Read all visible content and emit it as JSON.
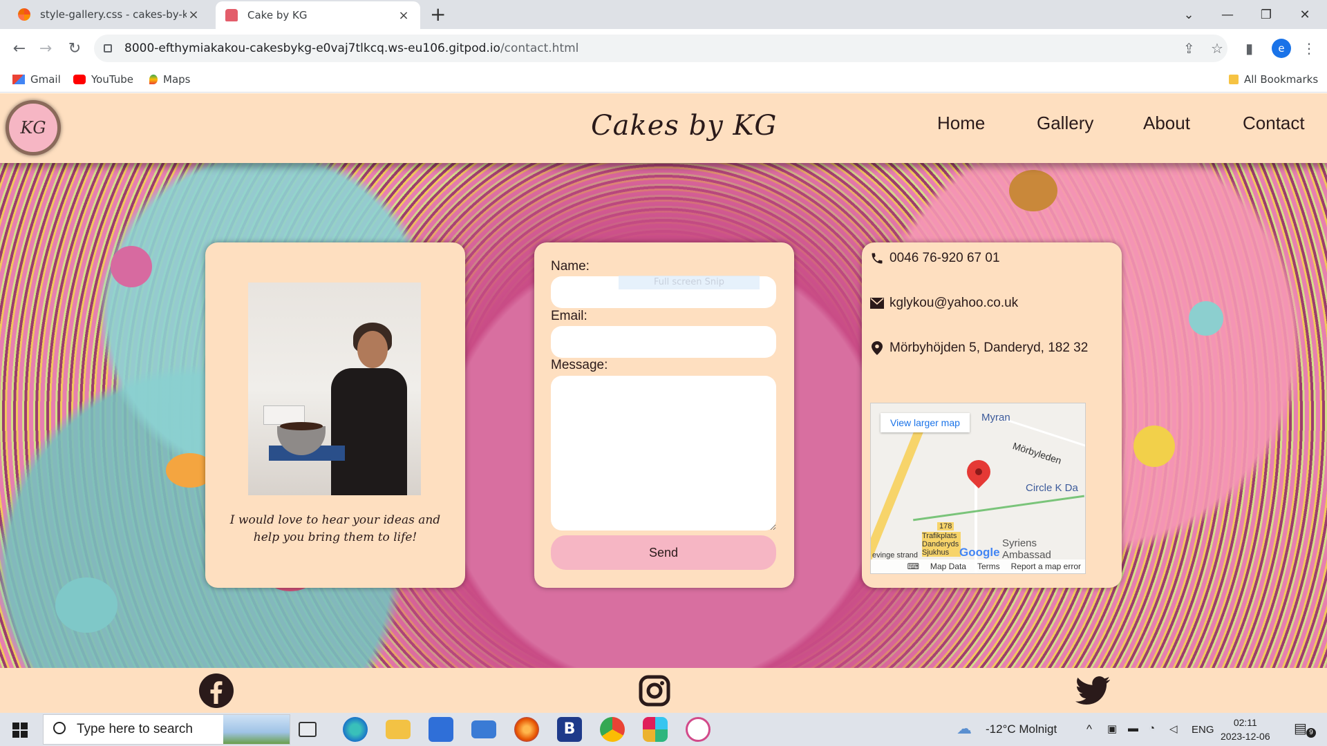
{
  "browser": {
    "tabs": [
      {
        "title": "style-gallery.css - cakes-by-kg -",
        "active": false
      },
      {
        "title": "Cake by KG",
        "active": true
      }
    ],
    "url_host": "8000-efthymiakakou-cakesbykg-e0vaj7tlkcq.ws-eu106.gitpod.io",
    "url_path": "/contact.html",
    "profile_initial": "e",
    "bookmarks": [
      "Gmail",
      "YouTube",
      "Maps"
    ],
    "all_bookmarks": "All Bookmarks"
  },
  "site": {
    "logo": "KG",
    "title": "Cakes by KG",
    "nav": [
      "Home",
      "Gallery",
      "About",
      "Contact"
    ],
    "quote": "I would love to hear your ideas and help you bring them to life!",
    "form": {
      "name_label": "Name:",
      "email_label": "Email:",
      "message_label": "Message:",
      "send_label": "Send",
      "overlay_text": "Full screen Snip"
    },
    "contact": {
      "phone": "0046 76-920 67 01",
      "email": "kglykou@yahoo.co.uk",
      "address": "Mörbyhöjden 5, Danderyd, 182 32"
    },
    "map": {
      "view_larger": "View larger map",
      "labels": [
        "Myran",
        "Mörbyleden",
        "Circle K Da",
        "Syriens Ambassad",
        "178",
        "Trafikplats Danderyds Sjukhus",
        "evinge strand"
      ],
      "footer": [
        "Map Data",
        "Terms",
        "Report a map error"
      ],
      "brand": "Google"
    },
    "social": [
      "facebook",
      "instagram",
      "twitter"
    ]
  },
  "taskbar": {
    "search_placeholder": "Type here to search",
    "weather": "-12°C  Molnigt",
    "language": "ENG",
    "time": "02:11",
    "date": "2023-12-06",
    "notifications": "9"
  },
  "colors": {
    "peach": "#fedfc0",
    "pink_button": "#f6b6c4",
    "text_dark": "#2a1a1a"
  }
}
